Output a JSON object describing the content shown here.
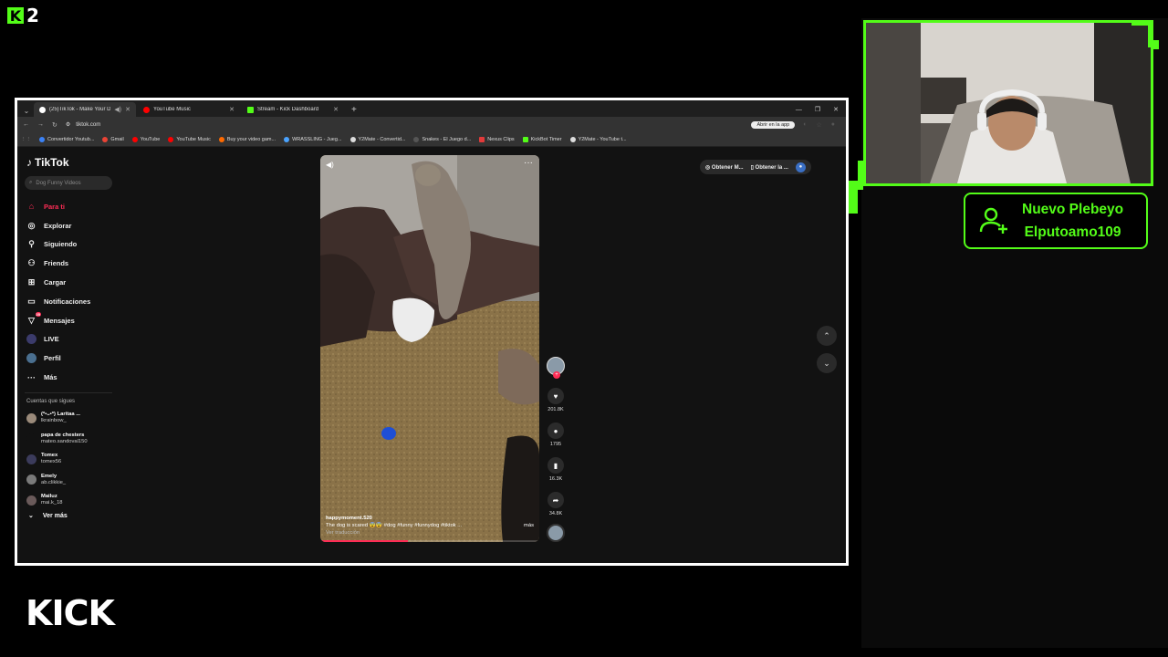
{
  "stream": {
    "channel_badge": "2",
    "kick_logo_text": "KICK",
    "accent_color": "#53fc18"
  },
  "alert": {
    "line1": "Nuevo Plebeyo",
    "line2": "Elputoamo109",
    "icon": "add-user-icon"
  },
  "browser": {
    "tabs": [
      {
        "label": "(25)TikTok - Make Your Day",
        "active": true,
        "fav_color": "#ffffff"
      },
      {
        "label": "YouTube Music",
        "active": false,
        "fav_color": "#ff0000"
      },
      {
        "label": "Stream - Kick Dashboard",
        "active": false,
        "fav_color": "#53fc18"
      }
    ],
    "url": "tiktok.com",
    "open_app_label": "Abrir en la app",
    "bookmarks": [
      {
        "label": "Convertidor Youtub...",
        "color": "#3b82f6"
      },
      {
        "label": "Gmail",
        "color": "#ea4335"
      },
      {
        "label": "YouTube",
        "color": "#ff0000"
      },
      {
        "label": "YouTube Music",
        "color": "#ff0000"
      },
      {
        "label": "Buy your video gam...",
        "color": "#ff6a00"
      },
      {
        "label": "WRASSLING - Jueg...",
        "color": "#4aa3ff"
      },
      {
        "label": "Y2Mate - Convertid...",
        "color": "#dddddd"
      },
      {
        "label": "Snakes - El Juego d...",
        "color": "#222222"
      },
      {
        "label": "Nexus Clips",
        "color": "#e23a3a"
      },
      {
        "label": "KickBot Timer",
        "color": "#53fc18"
      },
      {
        "label": "Y2Mate - YouTube t...",
        "color": "#dddddd"
      }
    ]
  },
  "tiktok": {
    "logo": "TikTok",
    "search_placeholder": "Dog Funny Videos",
    "nav": [
      {
        "label": "Para ti",
        "icon": "home-icon",
        "active": true
      },
      {
        "label": "Explorar",
        "icon": "compass-icon",
        "active": false
      },
      {
        "label": "Siguiendo",
        "icon": "following-icon",
        "active": false
      },
      {
        "label": "Friends",
        "icon": "friends-icon",
        "active": false
      },
      {
        "label": "Cargar",
        "icon": "upload-icon",
        "active": false
      },
      {
        "label": "Notificaciones",
        "icon": "bell-icon",
        "active": false
      },
      {
        "label": "Mensajes",
        "icon": "message-icon",
        "active": false,
        "badge": "25"
      },
      {
        "label": "LIVE",
        "icon": "live-icon",
        "active": false
      },
      {
        "label": "Perfil",
        "icon": "profile-icon",
        "active": false
      },
      {
        "label": "Más",
        "icon": "more-icon",
        "active": false
      }
    ],
    "following_header": "Cuentas que sigues",
    "following": [
      {
        "name": "(*•ᴗ•*) Laritaa ...",
        "handle": "lkrainbow_"
      },
      {
        "name": "papa de chesters",
        "handle": "mateo.sandoval150"
      },
      {
        "name": "Tomex",
        "handle": "tomex56"
      },
      {
        "name": "Emely",
        "handle": "ab.clikkie_"
      },
      {
        "name": "Mailuz",
        "handle": "mai.k_18"
      }
    ],
    "see_more": "Ver más",
    "top_pills": [
      "Obtener M...",
      "Obtener la ..."
    ],
    "video": {
      "author": "happymoment.520",
      "caption": "The dog is scared 😨😨 #dog #funny #funnydog #tiktok ...",
      "more": "más",
      "translation": "Ver traducción",
      "progress": 0.4
    },
    "actions": {
      "likes": "201.8K",
      "comments": "1795",
      "saves": "16.3K",
      "shares": "34.8K"
    }
  }
}
